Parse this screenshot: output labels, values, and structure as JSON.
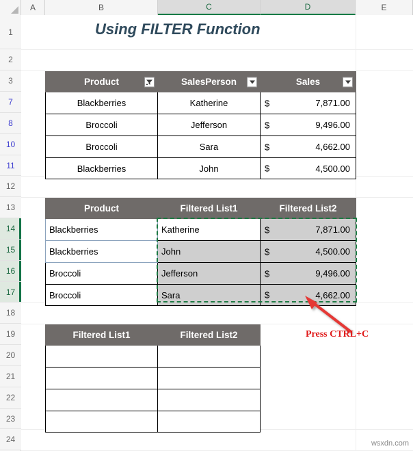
{
  "app": {
    "type": "spreadsheet",
    "watermark": "wsxdn.com"
  },
  "grid": {
    "column_headers": [
      {
        "label": "A",
        "selected": false
      },
      {
        "label": "B",
        "selected": false
      },
      {
        "label": "C",
        "selected": true
      },
      {
        "label": "D",
        "selected": true
      },
      {
        "label": "E",
        "selected": false
      }
    ],
    "row_headers": [
      {
        "label": "1",
        "state": "normal"
      },
      {
        "label": "2",
        "state": "normal"
      },
      {
        "label": "3",
        "state": "normal"
      },
      {
        "label": "7",
        "state": "filtered"
      },
      {
        "label": "8",
        "state": "filtered"
      },
      {
        "label": "10",
        "state": "filtered"
      },
      {
        "label": "11",
        "state": "filtered"
      },
      {
        "label": "12",
        "state": "normal"
      },
      {
        "label": "13",
        "state": "normal"
      },
      {
        "label": "14",
        "state": "selected"
      },
      {
        "label": "15",
        "state": "selected"
      },
      {
        "label": "16",
        "state": "selected"
      },
      {
        "label": "17",
        "state": "selected"
      },
      {
        "label": "18",
        "state": "normal"
      },
      {
        "label": "19",
        "state": "normal"
      },
      {
        "label": "20",
        "state": "normal"
      },
      {
        "label": "21",
        "state": "normal"
      },
      {
        "label": "22",
        "state": "normal"
      },
      {
        "label": "23",
        "state": "normal"
      },
      {
        "label": "24",
        "state": "normal"
      }
    ]
  },
  "title": "Using FILTER Function",
  "source_table": {
    "headers": [
      {
        "label": "Product",
        "filter_icon": "funnel-filter-applied-icon"
      },
      {
        "label": "SalesPerson",
        "filter_icon": "chevron-down-icon"
      },
      {
        "label": "Sales",
        "filter_icon": "chevron-down-icon"
      }
    ],
    "rows": [
      {
        "product": "Blackberries",
        "salesperson": "Katherine",
        "currency": "$",
        "sales": "7,871.00"
      },
      {
        "product": "Broccoli",
        "salesperson": "Jefferson",
        "currency": "$",
        "sales": "9,496.00"
      },
      {
        "product": "Broccoli",
        "salesperson": "Sara",
        "currency": "$",
        "sales": "4,662.00"
      },
      {
        "product": "Blackberries",
        "salesperson": "John",
        "currency": "$",
        "sales": "4,500.00"
      }
    ]
  },
  "result_table": {
    "headers": [
      {
        "label": "Product"
      },
      {
        "label": "Filtered List1"
      },
      {
        "label": "Filtered List2"
      }
    ],
    "rows": [
      {
        "product": "Blackberries",
        "list1": "Katherine",
        "currency": "$",
        "list2": "7,871.00",
        "selection": "active"
      },
      {
        "product": "Blackberries",
        "list1": "John",
        "currency": "$",
        "list2": "4,500.00",
        "selection": "selected"
      },
      {
        "product": "Broccoli",
        "list1": "Jefferson",
        "currency": "$",
        "list2": "9,496.00",
        "selection": "selected"
      },
      {
        "product": "Broccoli",
        "list1": "Sara",
        "currency": "$",
        "list2": "4,662.00",
        "selection": "selected"
      }
    ]
  },
  "empty_table": {
    "headers": [
      {
        "label": "Filtered List1"
      },
      {
        "label": "Filtered List2"
      }
    ],
    "rows": [
      {
        "list1": "",
        "list2": ""
      },
      {
        "list1": "",
        "list2": ""
      },
      {
        "list1": "",
        "list2": ""
      },
      {
        "list1": "",
        "list2": ""
      }
    ]
  },
  "annotation": {
    "text": "Press CTRL+C",
    "color": "#e01b1b",
    "arrow": "red-arrow-up-left"
  },
  "colors": {
    "header_fill": "#6f6b69",
    "selection_green": "#1d7a43",
    "selected_cell_fill": "#cfcfcf",
    "title_color": "#2f4a5c",
    "filtered_row_number": "#4040d0",
    "spill_border": "#8ba3bd"
  }
}
